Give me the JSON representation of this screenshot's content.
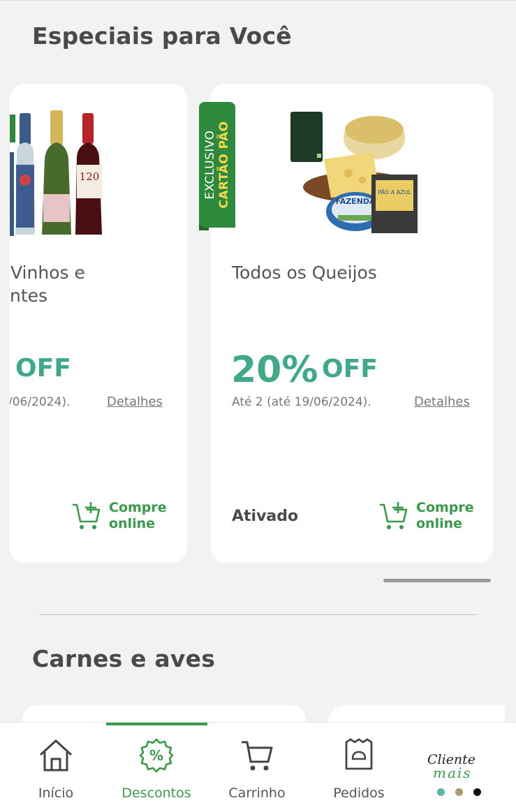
{
  "section1": {
    "title": "Especiais para Você"
  },
  "cards": [
    {
      "title_line1": "Vinhos e",
      "title_line2": "ntes",
      "off_word": "OFF",
      "until": "/06/2024).",
      "details": "Detalhes",
      "buy_label": "Compre online"
    },
    {
      "badge_line1": "EXCLUSIVO",
      "badge_line2": "CARTÃO PÃO",
      "title": "Todos os Queijos",
      "off_pct": "20%",
      "off_word": "OFF",
      "until": "Até 2  (até 19/06/2024).",
      "details": "Detalhes",
      "status": "Ativado",
      "buy_label": "Compre online",
      "product_labels": [
        "120",
        "FAZENDA",
        "PÃO A AZUL"
      ]
    }
  ],
  "section2": {
    "title": "Carnes e aves"
  },
  "bottom_nav": {
    "items": [
      {
        "label": "Início",
        "icon": "home-icon"
      },
      {
        "label": "Descontos",
        "icon": "discount-badge-icon",
        "active": true
      },
      {
        "label": "Carrinho",
        "icon": "cart-icon"
      },
      {
        "label": "Pedidos",
        "icon": "orders-bag-icon"
      }
    ],
    "logo_line1": "Cliente",
    "logo_line2": "mais",
    "dot_colors": [
      "#5fb3a8",
      "#a89a6e",
      "#111111"
    ]
  },
  "colors": {
    "accent_green": "#3a9a4a",
    "discount_teal": "#3fa98a",
    "badge_green": "#2d8a3c",
    "badge_yellow": "#f6d64a"
  }
}
